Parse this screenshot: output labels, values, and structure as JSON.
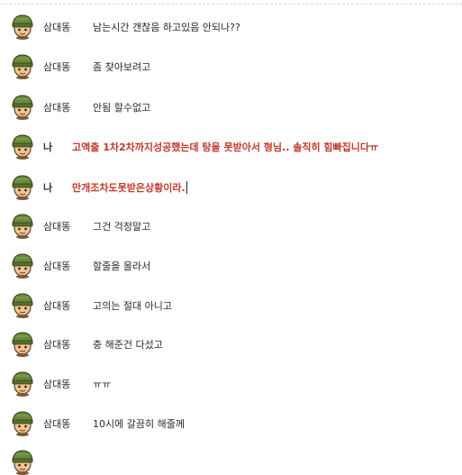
{
  "messages": [
    {
      "sender": "삼대똥",
      "text": "남는시간 갠찮음 하고있음 안되나??",
      "me": false
    },
    {
      "sender": "삼대똥",
      "text": "좀 찾아보려고",
      "me": false
    },
    {
      "sender": "삼대똥",
      "text": "안됨 할수없고",
      "me": false
    },
    {
      "sender": "나",
      "text": "고액출 1차2차까지성공했는데 탕을 못받아서 형님.. 솔직히 힘빠집니다ㅠ",
      "me": true
    },
    {
      "sender": "나",
      "text": "만개조차도못받은상황이라.",
      "me": true
    },
    {
      "sender": "삼대똥",
      "text": "그건 걱정말고",
      "me": false
    },
    {
      "sender": "삼대똥",
      "text": "할줄을 몰라서",
      "me": false
    },
    {
      "sender": "삼대똥",
      "text": "고의는 절대 아니고",
      "me": false
    },
    {
      "sender": "삼대똥",
      "text": "충 해준건 다섰고",
      "me": false
    },
    {
      "sender": "삼대똥",
      "text": "ㅠㅠ",
      "me": false
    },
    {
      "sender": "삼대똥",
      "text": "10시에 갈끔히 해줄께",
      "me": false
    }
  ],
  "colors": {
    "my_text": "#c0392b",
    "default_text": "#2a2a2a",
    "helmet": "#6b8a3a",
    "skin": "#f2c48f"
  },
  "icons": {
    "avatar": "soldier-avatar-icon"
  }
}
